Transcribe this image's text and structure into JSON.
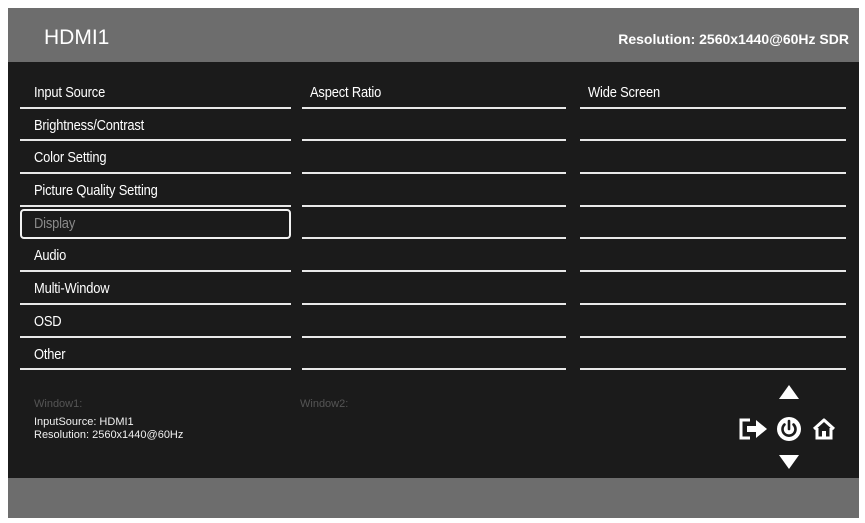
{
  "header": {
    "title": "HDMI1",
    "resolution": "Resolution: 2560x1440@60Hz SDR"
  },
  "menu": {
    "column1": [
      {
        "label": "Input Source"
      },
      {
        "label": "Brightness/Contrast"
      },
      {
        "label": "Color Setting"
      },
      {
        "label": "Picture Quality Setting"
      },
      {
        "label": "Display",
        "selected": true
      },
      {
        "label": "Audio"
      },
      {
        "label": "Multi-Window"
      },
      {
        "label": "OSD"
      },
      {
        "label": "Other"
      }
    ],
    "column2": [
      "Aspect Ratio",
      "",
      "",
      "",
      "",
      "",
      "",
      "",
      ""
    ],
    "column3": [
      "Wide Screen",
      "",
      "",
      "",
      "",
      "",
      "",
      "",
      ""
    ]
  },
  "window1": {
    "title": "Window1:",
    "input_source": "InputSource: HDMI1",
    "resolution": "Resolution: 2560x1440@60Hz"
  },
  "window2": {
    "title": "Window2:"
  },
  "controls": {
    "up": "triangle-up-icon",
    "down": "triangle-down-icon",
    "exit": "exit-icon",
    "power": "power-icon",
    "home": "home-icon"
  },
  "colors": {
    "background": "#1b1b1b",
    "bar": "#6d6d6d",
    "text": "#ffffff",
    "disabled_text": "#8a8a8a"
  }
}
